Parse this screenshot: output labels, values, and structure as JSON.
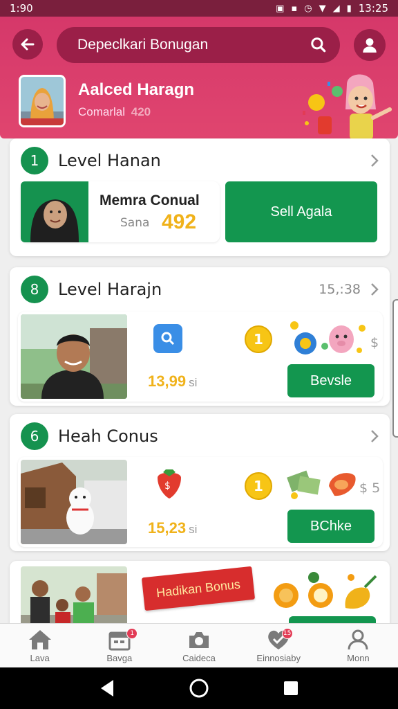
{
  "status_bar": {
    "time_left": "1:90",
    "time_right": "13:25"
  },
  "header": {
    "search_text": "Depeclkari Bonugan",
    "user_name": "Aalced Haragn",
    "user_sub_label": "Comarlal",
    "user_points": "420"
  },
  "cards": [
    {
      "badge": "1",
      "title": "Level Hanan",
      "feature_name": "Memra Conual",
      "feature_sub": "Sana",
      "feature_value": "492",
      "button": "Sell Agala"
    },
    {
      "badge": "8",
      "title": "Level Harajn",
      "meta": "15,:38",
      "coin": "1",
      "price": "13,99",
      "price_unit": "si",
      "dollar": "$",
      "button": "Bevsle"
    },
    {
      "badge": "6",
      "title": "Heah Conus",
      "coin": "1",
      "price": "15,23",
      "price_unit": "si",
      "dollar": "$ 5",
      "button": "BChke"
    },
    {
      "banner": "Hadikan Bonus"
    }
  ],
  "bottom_nav": [
    {
      "label": "Lava",
      "icon": "home-icon"
    },
    {
      "label": "Bavga",
      "icon": "calendar-icon",
      "badge": "1"
    },
    {
      "label": "Caideca",
      "icon": "camera-icon"
    },
    {
      "label": "Einnosiaby",
      "icon": "heart-check-icon",
      "badge": "15"
    },
    {
      "label": "Monn",
      "icon": "person-icon"
    }
  ],
  "colors": {
    "header": "#d5386a",
    "accent_green": "#13964f",
    "price": "#f0b21a"
  }
}
